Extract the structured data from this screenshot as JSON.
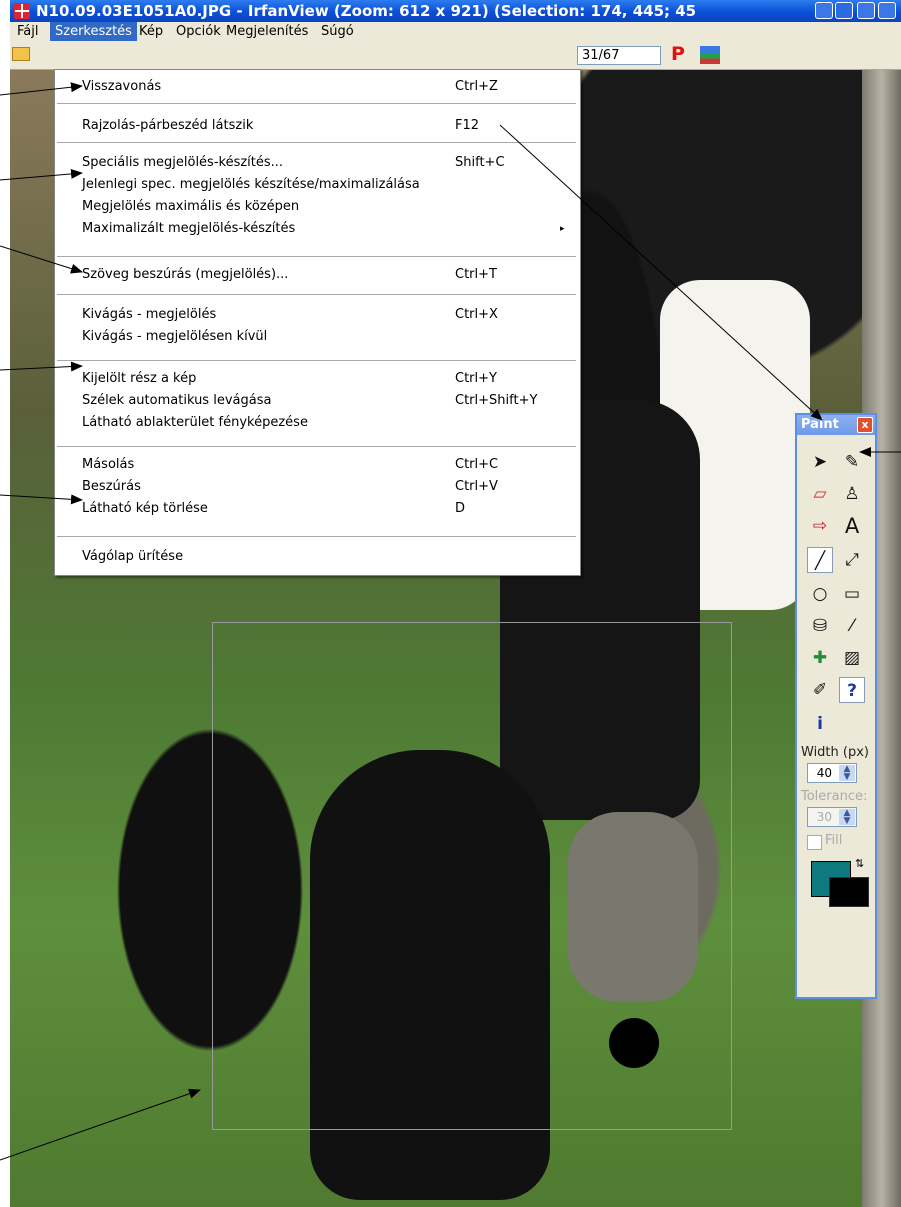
{
  "window": {
    "title": "N10.09.03E1051A0.JPG - IrfanView (Zoom: 612 x 921) (Selection: 174, 445; 45"
  },
  "menubar": [
    "Fájl",
    "Szerkesztés",
    "Kép",
    "Opciók",
    "Megjelenítés",
    "Súgó"
  ],
  "toolbar": {
    "page_counter": "31/67",
    "p_label": "P"
  },
  "edit_menu": {
    "items": [
      {
        "label": "Visszavonás",
        "shortcut": "Ctrl+Z"
      },
      {
        "label": "Rajzolás-párbeszéd látszik",
        "shortcut": "F12"
      },
      {
        "label": "Speciális megjelölés-készítés...",
        "shortcut": "Shift+C"
      },
      {
        "label": "Jelenlegi spec. megjelölés készítése/maximalizálása",
        "shortcut": ""
      },
      {
        "label": "Megjelölés maximális és középen",
        "shortcut": ""
      },
      {
        "label": "Maximalizált megjelölés-készítés",
        "shortcut": ""
      },
      {
        "label": "Szöveg beszúrás (megjelölés)...",
        "shortcut": "Ctrl+T"
      },
      {
        "label": "Kivágás - megjelölés",
        "shortcut": "Ctrl+X"
      },
      {
        "label": "Kivágás - megjelölésen kívül",
        "shortcut": ""
      },
      {
        "label": "Kijelölt rész a kép",
        "shortcut": "Ctrl+Y"
      },
      {
        "label": "Szélek automatikus levágása",
        "shortcut": "Ctrl+Shift+Y"
      },
      {
        "label": "Látható ablakterület fényképezése",
        "shortcut": ""
      },
      {
        "label": "Másolás",
        "shortcut": "Ctrl+C"
      },
      {
        "label": "Beszúrás",
        "shortcut": "Ctrl+V"
      },
      {
        "label": "Látható kép törlése",
        "shortcut": "D"
      },
      {
        "label": "Vágólap ürítése",
        "shortcut": ""
      }
    ],
    "submenu_arrow": "▸"
  },
  "paint": {
    "title": "Paint",
    "close": "x",
    "width_label": "Width (px)",
    "width_value": "40",
    "tolerance_label": "Tolerance:",
    "tolerance_value": "30",
    "fill_label": "Fill",
    "text_tool": "A",
    "help_tool": "?",
    "info_tool": "i",
    "foreground_color": "#0e7a80",
    "background_color": "#000000"
  }
}
